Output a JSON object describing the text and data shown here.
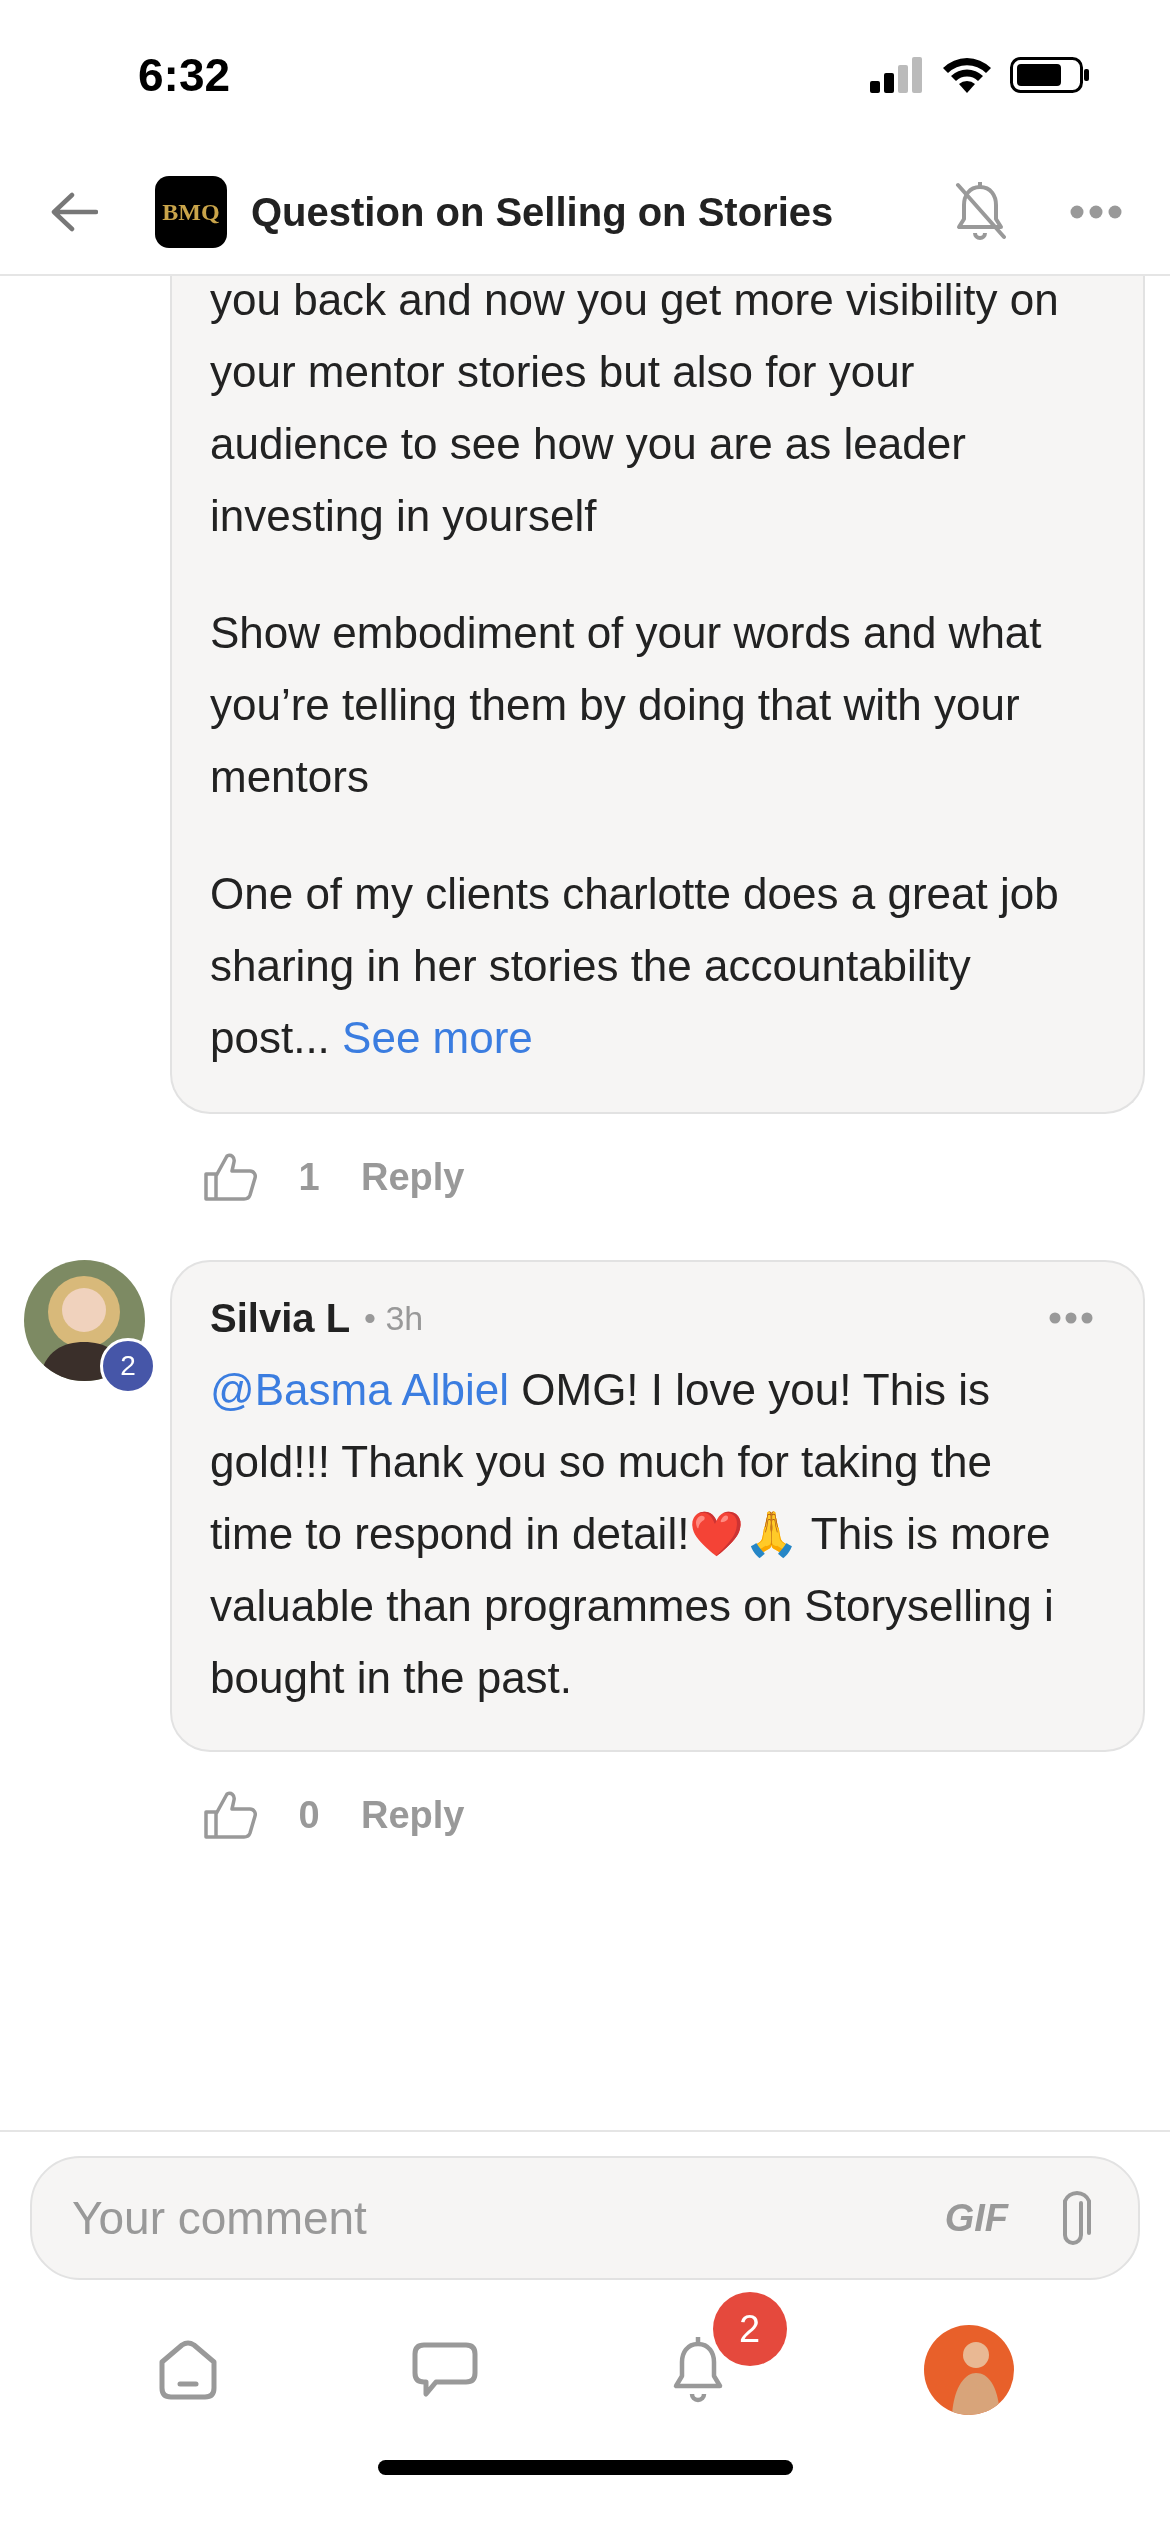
{
  "status_bar": {
    "time": "6:32"
  },
  "header": {
    "logo_text": "BMQ",
    "title": "Question on Selling on Stories",
    "notifications_muted": true
  },
  "comments": [
    {
      "kind": "continued",
      "paragraphs": [
        "you back and now you get more visibility on your mentor stories but also for your audience to see how you are as leader investing in yourself",
        "Show embodiment of your words and what you’re telling them by doing that with your mentors",
        "One of my clients charlotte does a great job sharing in her stories the accountability post..."
      ],
      "see_more": "See more",
      "likes": "1",
      "reply": "Reply"
    },
    {
      "kind": "full",
      "author": "Silvia L",
      "time": "• 3h",
      "badge": "2",
      "mention": "@Basma Albiel",
      "text": " OMG! I love you! This is gold!!! Thank you so much for taking the time to respond in detail!❤️🙏 This is more valuable than programmes on Storyselling i bought in the past.",
      "likes": "0",
      "reply": "Reply"
    }
  ],
  "composer": {
    "placeholder": "Your comment",
    "gif": "GIF"
  },
  "bottom_nav": {
    "notification_count": "2"
  }
}
